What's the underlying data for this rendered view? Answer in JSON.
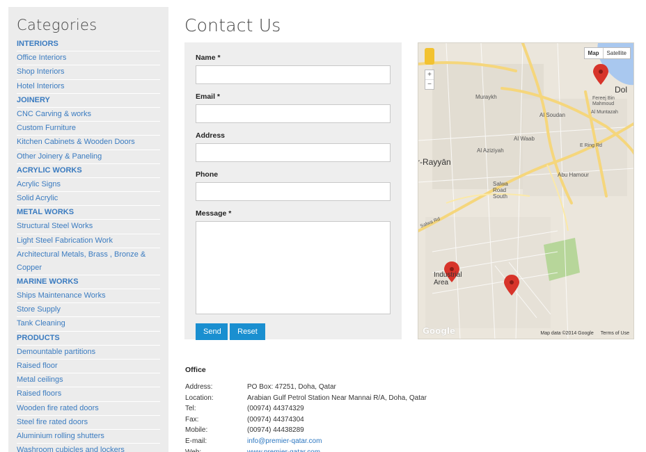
{
  "sidebar": {
    "title": "Categories",
    "items": [
      {
        "label": "INTERIORS",
        "heading": true
      },
      {
        "label": "Office Interiors",
        "heading": false
      },
      {
        "label": "Shop Interiors",
        "heading": false
      },
      {
        "label": "Hotel Interiors",
        "heading": false
      },
      {
        "label": "JOINERY",
        "heading": true
      },
      {
        "label": "CNC Carving & works",
        "heading": false
      },
      {
        "label": "Custom  Furniture",
        "heading": false
      },
      {
        "label": "Kitchen Cabinets & Wooden Doors",
        "heading": false
      },
      {
        "label": "Other Joinery & Paneling",
        "heading": false
      },
      {
        "label": "ACRYLIC WORKS",
        "heading": true
      },
      {
        "label": "Acrylic Signs",
        "heading": false
      },
      {
        "label": "Solid Acrylic",
        "heading": false
      },
      {
        "label": "METAL WORKS",
        "heading": true
      },
      {
        "label": "Structural Steel Works",
        "heading": false
      },
      {
        "label": "Light Steel Fabrication Work",
        "heading": false
      },
      {
        "label": "Architectural Metals, Brass , Bronze & Copper",
        "heading": false
      },
      {
        "label": "MARINE WORKS",
        "heading": true
      },
      {
        "label": "Ships Maintenance Works",
        "heading": false
      },
      {
        "label": "Store Supply",
        "heading": false
      },
      {
        "label": "Tank Cleaning",
        "heading": false
      },
      {
        "label": "PRODUCTS",
        "heading": true
      },
      {
        "label": "Demountable partitions",
        "heading": false
      },
      {
        "label": "Raised floor",
        "heading": false
      },
      {
        "label": "Metal ceilings",
        "heading": false
      },
      {
        "label": "Raised floors",
        "heading": false
      },
      {
        "label": "Wooden fire rated doors",
        "heading": false
      },
      {
        "label": "Steel fire rated doors",
        "heading": false
      },
      {
        "label": "Aluminium rolling shutters",
        "heading": false
      },
      {
        "label": "Washroom cubicles and lockers",
        "heading": false
      }
    ]
  },
  "main": {
    "title": "Contact Us"
  },
  "form": {
    "name_label": "Name *",
    "email_label": "Email *",
    "address_label": "Address",
    "phone_label": "Phone",
    "message_label": "Message *",
    "send_label": "Send",
    "reset_label": "Reset",
    "send_color": "#1a8fd0"
  },
  "map": {
    "type_map": "Map",
    "type_satellite": "Satellite",
    "zoom_in": "+",
    "zoom_out": "−",
    "logo": "Google",
    "data_text": "Map data ©2014 Google",
    "terms_text": "Terms of Use",
    "labels": {
      "rayyan": "r-Rayyān",
      "doha": "Dol",
      "industrial": "Industrial Area",
      "murraykh": "Muraykh",
      "al_soudan": "Al Soudan",
      "al_waab": "Al Waab",
      "al_aziziyah": "Al Aziziyah",
      "salwa_road_south": "Salwa Road South",
      "abu_hamour": "Abu Hamour",
      "fereej": "Fereej Bin Mahmoud",
      "al_muntazah": "Al Muntazah",
      "salwa_rd": "Salwa Rd",
      "ring_rd": "E Ring Rd"
    },
    "marker_color": "#d7342a"
  },
  "office": {
    "heading": "Office",
    "rows": [
      {
        "key": "Address:",
        "value": "PO Box: 47251, Doha, Qatar"
      },
      {
        "key": "Location:",
        "value": "Arabian Gulf Petrol Station Near Mannai R/A, Doha, Qatar"
      },
      {
        "key": "Tel:",
        "value": "(00974) 44374329"
      },
      {
        "key": "Fax:",
        "value": "(00974) 44374304"
      },
      {
        "key": "Mobile:",
        "value": "(00974) 44438289"
      },
      {
        "key": "E-mail:",
        "value": "info@premier-qatar.com"
      },
      {
        "key": "Web:",
        "value": "www.premier-qatar.com"
      }
    ]
  }
}
